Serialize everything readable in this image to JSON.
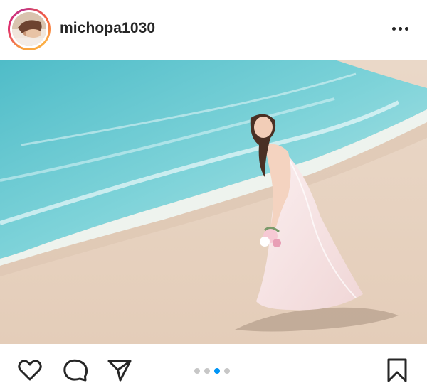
{
  "post": {
    "username": "michopa1030",
    "carousel": {
      "count": 4,
      "active_index": 2
    }
  },
  "icons": {
    "more": "more-horizontal-icon",
    "like": "heart-icon",
    "comment": "comment-icon",
    "share": "send-icon",
    "save": "bookmark-icon"
  },
  "colors": {
    "text": "#262626",
    "active_dot": "#0095f6",
    "inactive_dot": "#c7c7c7"
  }
}
